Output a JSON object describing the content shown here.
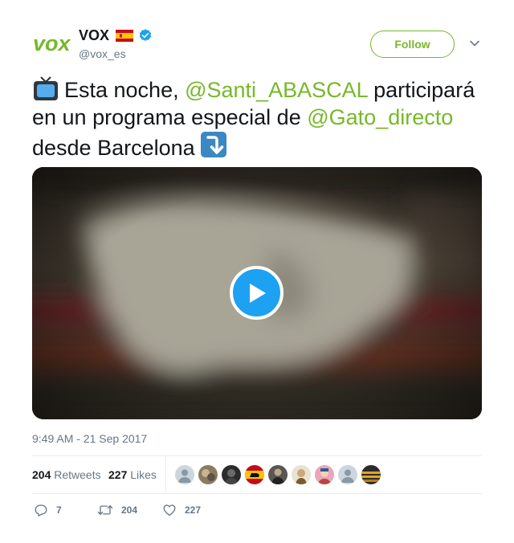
{
  "account": {
    "name": "VOX",
    "handle": "@vox_es",
    "logo_text": "vox",
    "brand_color": "#76b82a",
    "flag_icon": "spain-flag-icon",
    "verified_icon": "verified-badge-icon"
  },
  "follow_button": {
    "label": "Follow"
  },
  "tweet": {
    "part1": "Esta noche, ",
    "mention1": "@Santi_ABASCAL",
    "part2": " participará en un programa especial de ",
    "mention2": "@Gato_directo",
    "part3": " desde Barcelona",
    "emoji_start": "television-icon",
    "emoji_end": "arrow-down-right-icon"
  },
  "media": {
    "type": "video",
    "play_icon": "play-icon",
    "play_color": "#1da1f2"
  },
  "timestamp": "9:49 AM - 21 Sep 2017",
  "stats": {
    "retweets_count": "204",
    "retweets_label": "Retweets",
    "likes_count": "227",
    "likes_label": "Likes"
  },
  "actions": {
    "reply_count": "7",
    "retweet_count": "204",
    "like_count": "227"
  }
}
